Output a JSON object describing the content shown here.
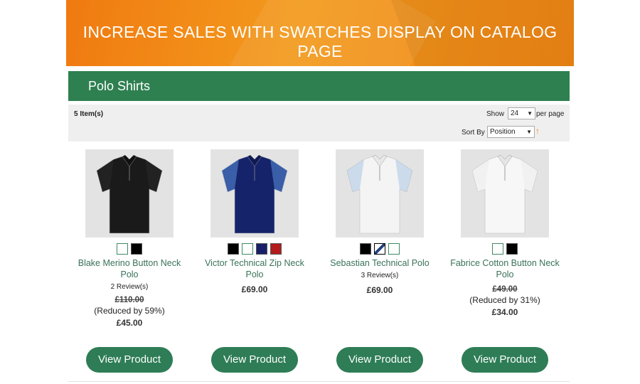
{
  "banner": {
    "title": "INCREASE SALES WITH SWATCHES DISPLAY ON CATALOG PAGE"
  },
  "category": {
    "title": "Polo Shirts"
  },
  "toolbar": {
    "item_count": "5 Item(s)",
    "show_label": "Show",
    "per_page_value": "24",
    "per_page_label": "per page",
    "sort_by_label": "Sort By",
    "sort_value": "Position",
    "sort_direction_icon": "arrow-up-icon"
  },
  "products": [
    {
      "name": "Blake Merino Button Neck Polo",
      "image_color": "black",
      "swatches": [
        "white",
        "black"
      ],
      "reviews": "2 Review(s)",
      "old_price": "£110.00",
      "reduced": "(Reduced by 59%)",
      "price": "£45.00",
      "button": "View Product"
    },
    {
      "name": "Victor Technical Zip Neck Polo",
      "image_color": "navy",
      "swatches": [
        "black",
        "white",
        "navy",
        "red"
      ],
      "reviews": "",
      "old_price": "",
      "reduced": "",
      "price": "£69.00",
      "button": "View Product"
    },
    {
      "name": "Sebastian Technical Polo",
      "image_color": "white-blue",
      "swatches": [
        "black",
        "pattern",
        "white"
      ],
      "reviews": "3 Review(s)",
      "old_price": "",
      "reduced": "",
      "price": "£69.00",
      "button": "View Product"
    },
    {
      "name": "Fabrice Cotton Button Neck Polo",
      "image_color": "white",
      "swatches": [
        "white",
        "black"
      ],
      "reviews": "",
      "old_price": "£49.00",
      "reduced": "(Reduced by 31%)",
      "price": "£34.00",
      "button": "View Product"
    }
  ],
  "colors": {
    "brand_green": "#2e8050",
    "banner_orange": "#f08515"
  }
}
